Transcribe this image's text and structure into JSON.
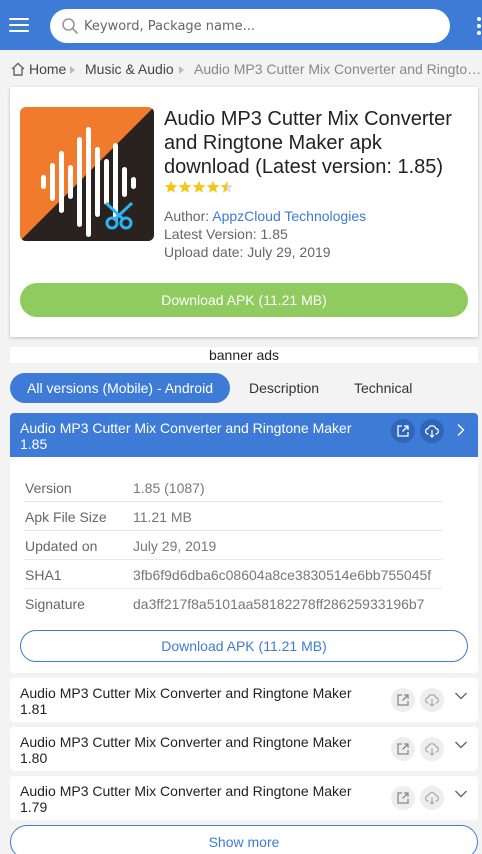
{
  "search": {
    "placeholder": "Keyword, Package name..."
  },
  "breadcrumb": {
    "home": "Home",
    "category": "Music & Audio",
    "current": "Audio MP3 Cutter Mix Converter and Ringtone Maker"
  },
  "app": {
    "title": "Audio MP3 Cutter Mix Converter and Ringtone Maker apk download (Latest version: 1.85)",
    "rating": 4.5,
    "author_label": "Author:",
    "author": "AppzCloud Technologies",
    "latest_version_label": "Latest Version:",
    "latest_version": "1.85",
    "upload_date_label": "Upload date:",
    "upload_date": "July 29, 2019",
    "download_label": "Download APK (11.21 MB)"
  },
  "banner": "banner ads",
  "tabs": [
    "All versions (Mobile) - Android",
    "Description",
    "Technical"
  ],
  "current_version": {
    "title": "Audio MP3 Cutter Mix Converter and Ringtone Maker 1.85",
    "specs": [
      {
        "label": "Version",
        "value": "1.85 (1087)"
      },
      {
        "label": "Apk File Size",
        "value": "11.21 MB"
      },
      {
        "label": "Updated on",
        "value": "July 29, 2019"
      },
      {
        "label": "SHA1",
        "value": "3fb6f9d6dba6c08604a8ce3830514e6bb755045f"
      },
      {
        "label": "Signature",
        "value": "da3ff217f8a5101aa58182278ff28625933196b7"
      }
    ],
    "download_label": "Download APK (11.21 MB)"
  },
  "other_versions": [
    {
      "title": "Audio MP3 Cutter Mix Converter and Ringtone Maker 1.81"
    },
    {
      "title": "Audio MP3 Cutter Mix Converter and Ringtone Maker 1.80"
    },
    {
      "title": "Audio MP3 Cutter Mix Converter and Ringtone Maker 1.79"
    }
  ],
  "show_more": "Show more",
  "colors": {
    "primary": "#3d7bd6",
    "download_green": "#8fcb5e",
    "app_icon_orange": "#f07b2c",
    "star": "#f5c518"
  }
}
